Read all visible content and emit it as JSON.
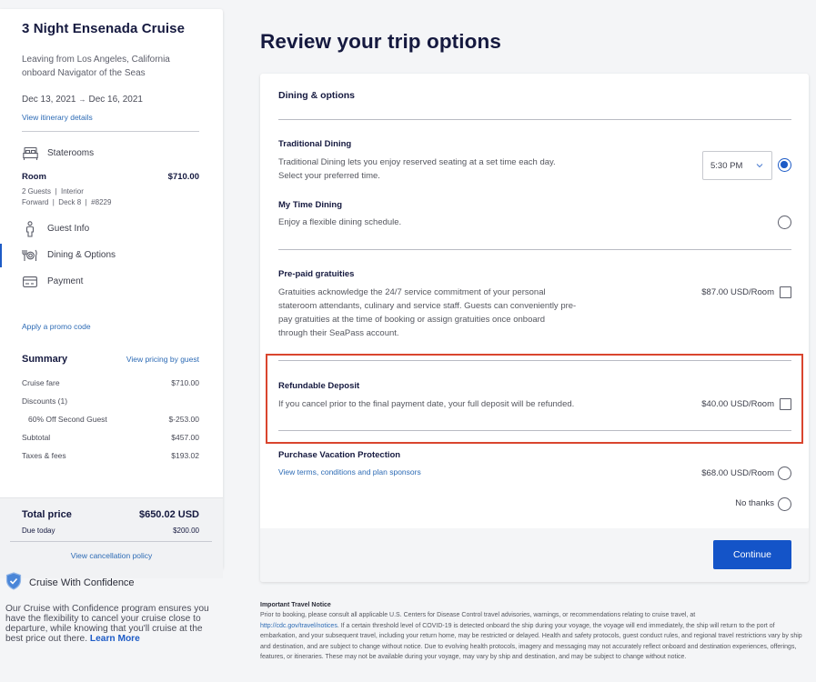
{
  "sidebar": {
    "title": "3 Night Ensenada Cruise",
    "departure_line1": "Leaving from Los Angeles, California",
    "departure_line2": "onboard Navigator of the Seas",
    "start_date": "Dec 13, 2021",
    "date_arrow": "→",
    "end_date": "Dec 16, 2021",
    "itinerary_link": "View itinerary details",
    "nav": {
      "staterooms": "Staterooms",
      "guest_info": "Guest Info",
      "dining_options": "Dining & Options",
      "payment": "Payment",
      "active": "dining_options"
    },
    "room": {
      "label": "Room",
      "price": "$710.00",
      "meta_line1": "2 Guests  |  Interior",
      "meta_line2": "Forward  |  Deck 8  |  #8229"
    },
    "promo_link": "Apply a promo code",
    "summary": {
      "title": "Summary",
      "pricing_link": "View pricing by guest",
      "rows": [
        {
          "label": "Cruise fare",
          "value": "$710.00"
        },
        {
          "label": "Discounts (1)",
          "value": ""
        },
        {
          "label": "60% Off Second Guest",
          "value": "$-253.00"
        },
        {
          "label": "Subtotal",
          "value": "$457.00"
        },
        {
          "label": "Taxes & fees",
          "value": "$193.02"
        }
      ]
    },
    "total": {
      "label": "Total price",
      "value": "$650.02 USD",
      "due_label": "Due today",
      "due_value": "$200.00",
      "cancellation_link": "View cancellation policy"
    },
    "confidence": {
      "title": "Cruise With Confidence",
      "text": "Our Cruise with Confidence program ensures you have the flexibility to cancel your cruise close to departure, while knowing that you'll cruise at the best price out there.",
      "link": "Learn More"
    }
  },
  "main": {
    "page_title": "Review your trip options",
    "section_title": "Dining & options",
    "traditional_dining": {
      "title": "Traditional Dining",
      "desc_line1": "Traditional Dining lets you enjoy reserved seating at a set time each day.",
      "desc_line2": "Select your preferred time.",
      "time_selected": "5:30 PM",
      "selected": true
    },
    "my_time_dining": {
      "title": "My Time Dining",
      "desc": "Enjoy a flexible dining schedule.",
      "selected": false
    },
    "gratuities": {
      "title": "Pre-paid gratuities",
      "desc_lines": [
        "Gratuities acknowledge the 24/7 service commitment of your personal",
        "stateroom attendants, culinary and service staff. Guests can conveniently pre-",
        "pay gratuities at the time of booking or assign gratuities once onboard",
        "through their SeaPass account."
      ],
      "price": "$87.00 USD/Room",
      "checked": false
    },
    "refundable_deposit": {
      "title": "Refundable Deposit",
      "desc": "If you cancel prior to the final payment date, your full deposit will be refunded.",
      "price": "$40.00 USD/Room",
      "checked": false
    },
    "vacation_protection": {
      "title": "Purchase Vacation Protection",
      "terms_link": "View terms, conditions and plan sponsors",
      "option_price": "$68.00 USD/Room",
      "option_decline": "No thanks"
    },
    "continue_label": "Continue",
    "notice": {
      "title": "Important Travel Notice",
      "text_before_link": "Prior to booking, please consult all applicable U.S. Centers for Disease Control travel advisories, warnings, or recommendations relating to cruise travel, at",
      "link": "http://cdc.gov/travel/notices",
      "text_after_link": ". If a certain threshold level of COVID-19 is detected onboard the ship during your voyage, the voyage will end immediately, the ship will return to the port of embarkation, and your subsequent travel, including your return home, may be restricted or delayed. Health and safety protocols, guest conduct rules, and regional travel restrictions vary by ship and destination, and are subject to change without notice. Due to evolving health protocols, imagery and messaging may not accurately reflect onboard and destination experiences, offerings, features, or itineraries. These may not be available during your voyage, may vary by ship and destination, and may be subject to change without notice."
    }
  },
  "colors": {
    "accent": "#1d5bc6",
    "button": "#1454c8",
    "link": "#2d6bb5",
    "highlight": "#d9452e",
    "heading": "#15193f",
    "page_bg": "#f4f5f7"
  }
}
